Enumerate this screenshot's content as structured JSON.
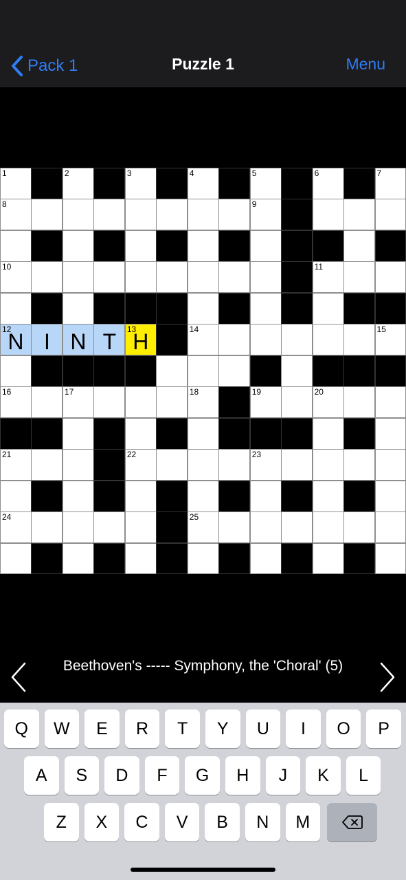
{
  "nav": {
    "back_label": "Pack 1",
    "title": "Puzzle 1",
    "menu_label": "Menu"
  },
  "grid": {
    "size": 13,
    "rows": [
      ".#.#.#.#.#.#.",
      ".........#...",
      ".#.#.#.#.##.#",
      ".........#...",
      ".#.###.#.#.##",
      ".....#.......",
      ".####...#.###",
      ".......#.....",
      "##.#.#.###.#.",
      "...#.........",
      ".#.#.#.#.#.#.",
      ".....#.......",
      ".#.#.#.#.#.#."
    ],
    "numbers": [
      {
        "r": 0,
        "c": 0,
        "n": "1"
      },
      {
        "r": 0,
        "c": 2,
        "n": "2"
      },
      {
        "r": 0,
        "c": 4,
        "n": "3"
      },
      {
        "r": 0,
        "c": 6,
        "n": "4"
      },
      {
        "r": 0,
        "c": 8,
        "n": "5"
      },
      {
        "r": 0,
        "c": 10,
        "n": "6"
      },
      {
        "r": 0,
        "c": 12,
        "n": "7"
      },
      {
        "r": 1,
        "c": 0,
        "n": "8"
      },
      {
        "r": 1,
        "c": 8,
        "n": "9"
      },
      {
        "r": 3,
        "c": 0,
        "n": "10"
      },
      {
        "r": 3,
        "c": 10,
        "n": "11"
      },
      {
        "r": 5,
        "c": 0,
        "n": "12"
      },
      {
        "r": 5,
        "c": 4,
        "n": "13"
      },
      {
        "r": 5,
        "c": 6,
        "n": "14"
      },
      {
        "r": 5,
        "c": 12,
        "n": "15"
      },
      {
        "r": 7,
        "c": 0,
        "n": "16"
      },
      {
        "r": 7,
        "c": 2,
        "n": "17"
      },
      {
        "r": 7,
        "c": 6,
        "n": "18"
      },
      {
        "r": 7,
        "c": 8,
        "n": "19"
      },
      {
        "r": 7,
        "c": 10,
        "n": "20"
      },
      {
        "r": 9,
        "c": 0,
        "n": "21"
      },
      {
        "r": 9,
        "c": 4,
        "n": "22"
      },
      {
        "r": 9,
        "c": 8,
        "n": "23"
      },
      {
        "r": 11,
        "c": 0,
        "n": "24"
      },
      {
        "r": 11,
        "c": 6,
        "n": "25"
      }
    ],
    "letters": [
      {
        "r": 5,
        "c": 0,
        "l": "N"
      },
      {
        "r": 5,
        "c": 1,
        "l": "I"
      },
      {
        "r": 5,
        "c": 2,
        "l": "N"
      },
      {
        "r": 5,
        "c": 3,
        "l": "T"
      },
      {
        "r": 5,
        "c": 4,
        "l": "H"
      }
    ],
    "active_word": {
      "row": 5,
      "from": 0,
      "to": 4
    },
    "cursor": {
      "row": 5,
      "col": 4
    },
    "colors": {
      "word_highlight": "#b8d6f7",
      "cursor": "#ffee00"
    }
  },
  "clue": {
    "text": "Beethoven's ----- Symphony, the 'Choral' (5)",
    "prev_icon": "chevron-left-icon",
    "next_icon": "chevron-right-icon"
  },
  "keyboard": {
    "rows": [
      [
        "Q",
        "W",
        "E",
        "R",
        "T",
        "Y",
        "U",
        "I",
        "O",
        "P"
      ],
      [
        "A",
        "S",
        "D",
        "F",
        "G",
        "H",
        "J",
        "K",
        "L"
      ],
      [
        "Z",
        "X",
        "C",
        "V",
        "B",
        "N",
        "M"
      ]
    ],
    "delete_icon": "backspace-icon"
  }
}
